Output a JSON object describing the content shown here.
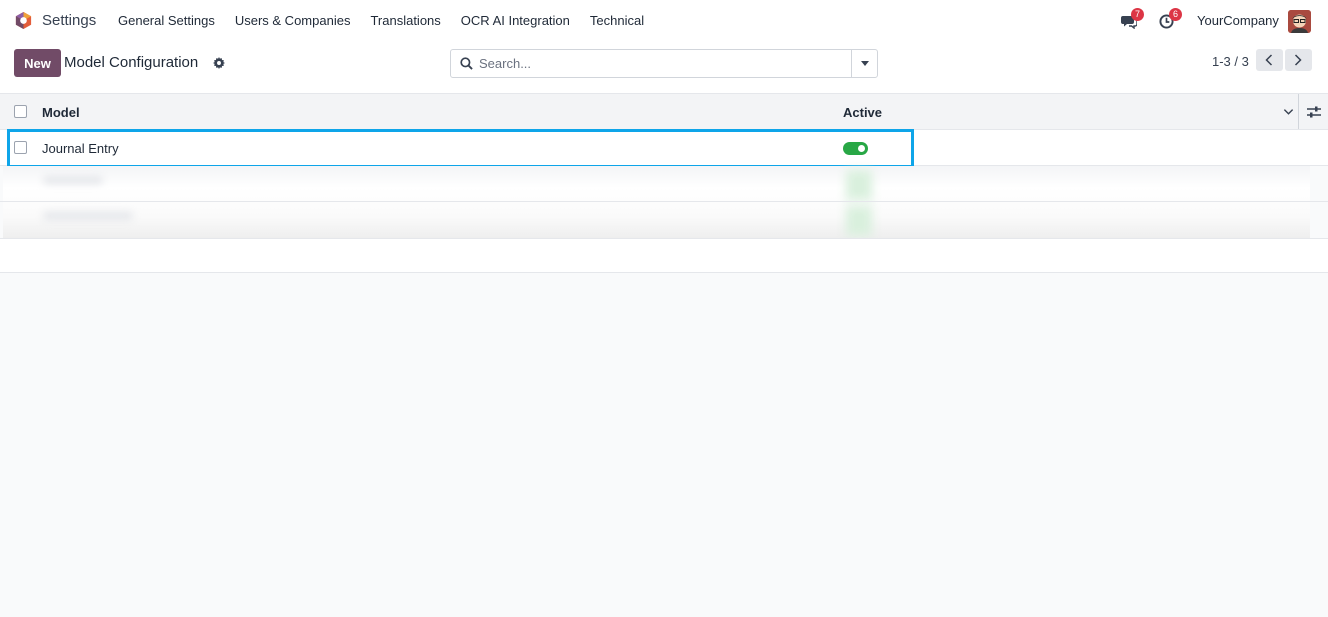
{
  "navbar": {
    "app_name": "Settings",
    "menu": [
      {
        "label": "General Settings"
      },
      {
        "label": "Users & Companies"
      },
      {
        "label": "Translations"
      },
      {
        "label": "OCR AI Integration"
      },
      {
        "label": "Technical"
      }
    ],
    "messages_count": "7",
    "activities_count": "6",
    "company": "YourCompany"
  },
  "control_panel": {
    "new_label": "New",
    "title": "Model Configuration",
    "search_placeholder": "Search...",
    "pager_value": "1-3 / 3"
  },
  "list": {
    "columns": {
      "model": "Model",
      "active": "Active"
    },
    "rows": [
      {
        "model": "Journal Entry",
        "active": true
      }
    ]
  },
  "colors": {
    "primary": "#714b67",
    "active_toggle": "#28a745",
    "highlight": "#0ea5e9",
    "badge": "#dc3545"
  }
}
